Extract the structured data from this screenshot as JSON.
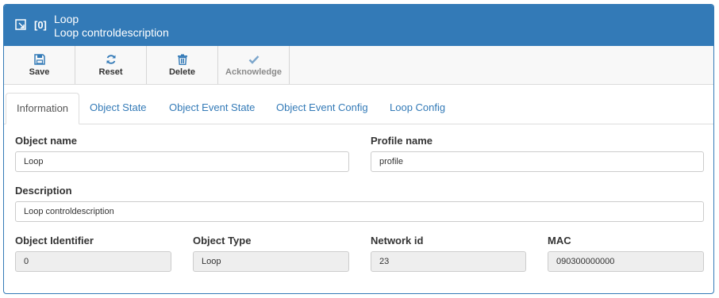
{
  "header": {
    "index": "[0]",
    "title": "Loop",
    "subtitle": "Loop controldescription"
  },
  "toolbar": {
    "save_label": "Save",
    "reset_label": "Reset",
    "delete_label": "Delete",
    "acknowledge_label": "Acknowledge"
  },
  "tabs": [
    {
      "label": "Information"
    },
    {
      "label": "Object State"
    },
    {
      "label": "Object Event State"
    },
    {
      "label": "Object Event Config"
    },
    {
      "label": "Loop Config"
    }
  ],
  "form": {
    "object_name": {
      "label": "Object name",
      "value": "Loop"
    },
    "profile_name": {
      "label": "Profile name",
      "value": "profile"
    },
    "description": {
      "label": "Description",
      "value": "Loop controldescription"
    },
    "object_identifier": {
      "label": "Object Identifier",
      "value": "0"
    },
    "object_type": {
      "label": "Object Type",
      "value": "Loop"
    },
    "network_id": {
      "label": "Network id",
      "value": "23"
    },
    "mac": {
      "label": "MAC",
      "value": "090300000000"
    }
  },
  "colors": {
    "header_bg": "#337ab7",
    "link": "#337ab7",
    "readonly_bg": "#eeeeee"
  }
}
